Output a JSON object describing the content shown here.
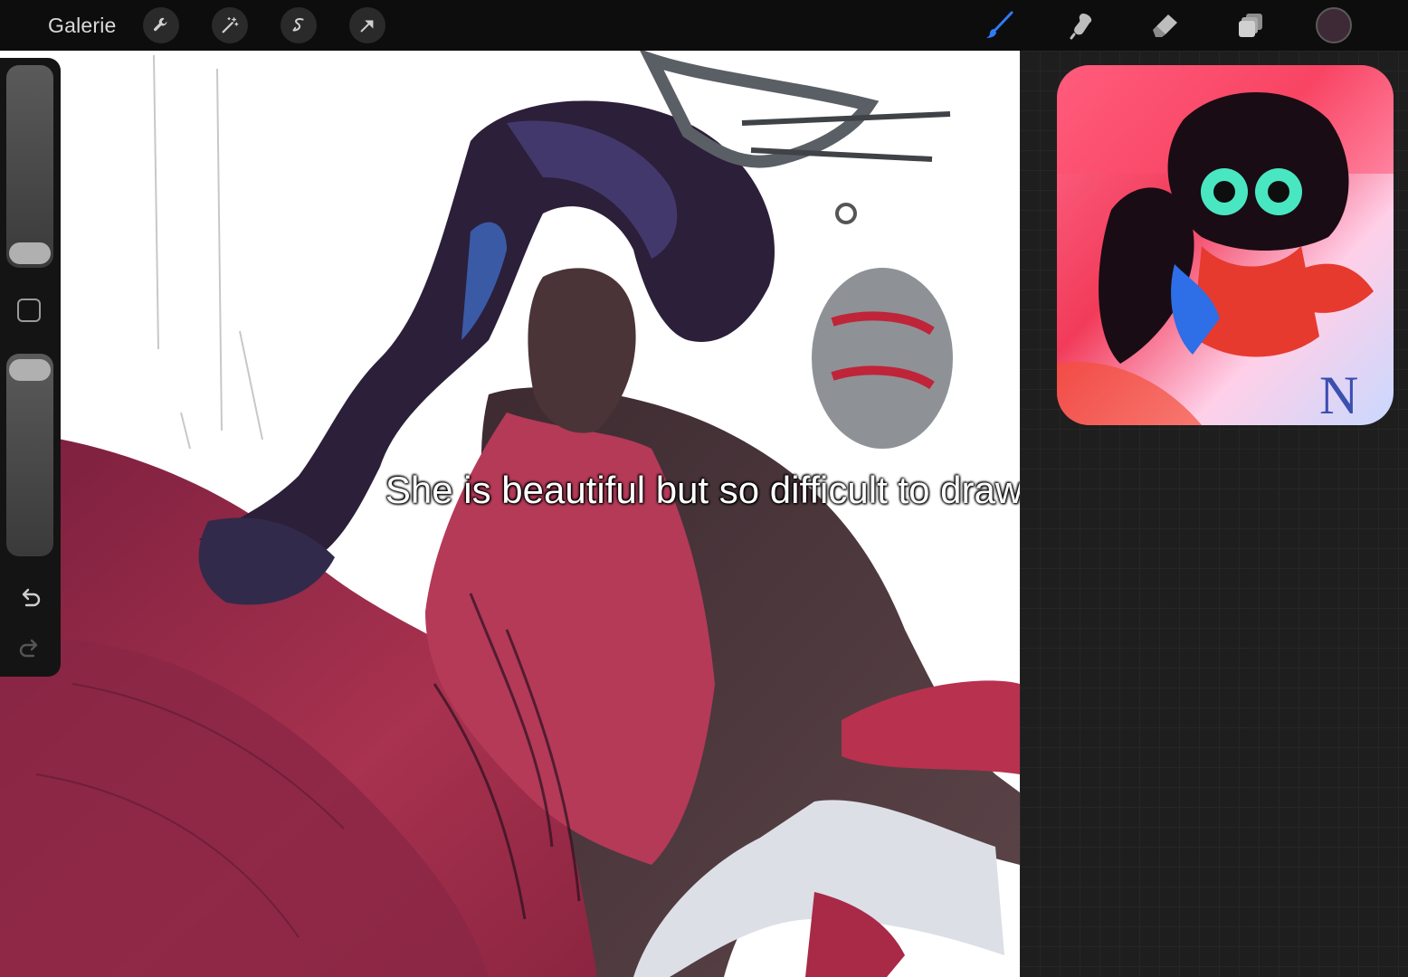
{
  "toolbar": {
    "gallery_label": "Galerie",
    "left_tools": [
      {
        "icon": "wrench-icon"
      },
      {
        "icon": "magic-wand-icon"
      },
      {
        "icon": "selection-icon"
      },
      {
        "icon": "transform-arrow-icon"
      }
    ],
    "right_tools": [
      {
        "icon": "brush-icon",
        "active": true
      },
      {
        "icon": "smudge-icon"
      },
      {
        "icon": "eraser-icon"
      },
      {
        "icon": "layers-icon"
      }
    ],
    "current_color": "#3d2a36"
  },
  "canvas": {
    "caption": "She is beautiful but so difficult to draw"
  },
  "sidebar": {
    "undo_icon": "undo-icon",
    "redo_icon": "redo-icon",
    "modify_icon": "square-icon"
  },
  "colors": {
    "accent": "#2f7bf5",
    "dress": "#a8324f",
    "hair": "#2c1f3a",
    "skin": "#4a3438"
  }
}
